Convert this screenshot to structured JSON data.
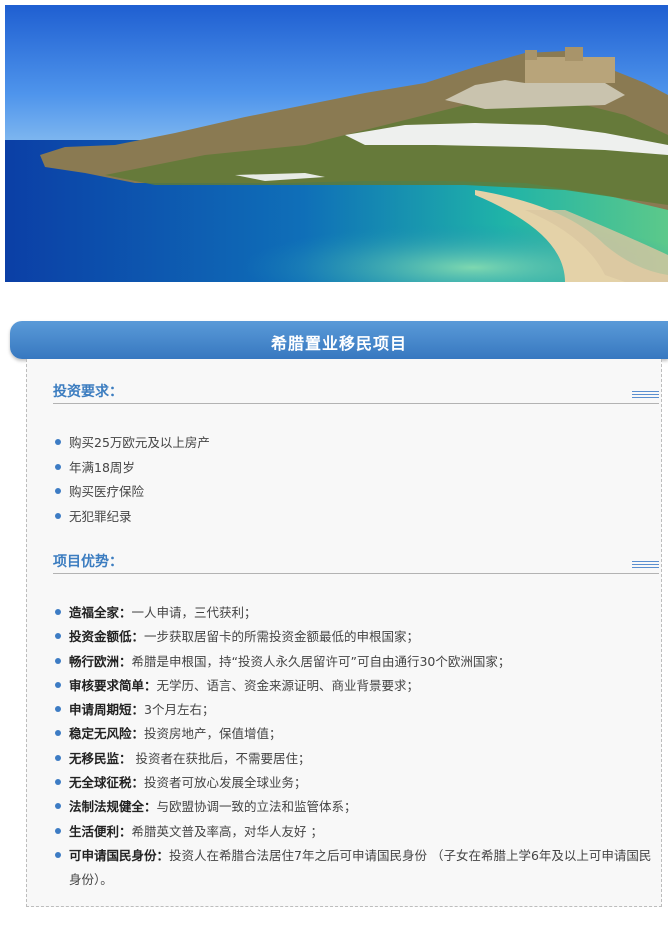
{
  "hero": {
    "image": "seaside-village-on-hill-with-turquoise-bay"
  },
  "banner": {
    "title": "希腊置业移民项目"
  },
  "investment": {
    "heading": "投资要求：",
    "items": [
      "购买25万欧元及以上房产",
      "年满18周岁",
      "购买医疗保险",
      "无犯罪纪录"
    ]
  },
  "advantages": {
    "heading": "项目优势：",
    "items": [
      {
        "title": "造福全家：",
        "text": "一人申请，三代获利；"
      },
      {
        "title": "投资金额低：",
        "text": "一步获取居留卡的所需投资金额最低的申根国家；"
      },
      {
        "title": "畅行欧洲：",
        "text": "希腊是申根国，持“投资人永久居留许可”可自由通行30个欧洲国家；"
      },
      {
        "title": "审核要求简单：",
        "text": "无学历、语言、资金来源证明、商业背景要求；"
      },
      {
        "title": "申请周期短：",
        "text": "3个月左右；"
      },
      {
        "title": "稳定无风险：",
        "text": "投资房地产，保值增值；"
      },
      {
        "title": "无移民监：",
        "text": " 投资者在获批后，不需要居住；"
      },
      {
        "title": "无全球征税：",
        "text": "投资者可放心发展全球业务；"
      },
      {
        "title": "法制法规健全：",
        "text": "与欧盟协调一致的立法和监管体系；"
      },
      {
        "title": "生活便利：",
        "text": "希腊英文普及率高，对华人友好 ；"
      },
      {
        "title": "可申请国民身份：",
        "text": "投资人在希腊合法居住7年之后可申请国民身份 （子女在希腊上学6年及以上可申请国民身份）。"
      }
    ]
  },
  "colors": {
    "accent": "#3c7dc0",
    "banner": "#4a8ad0",
    "bullet": "#3d7cc4"
  }
}
